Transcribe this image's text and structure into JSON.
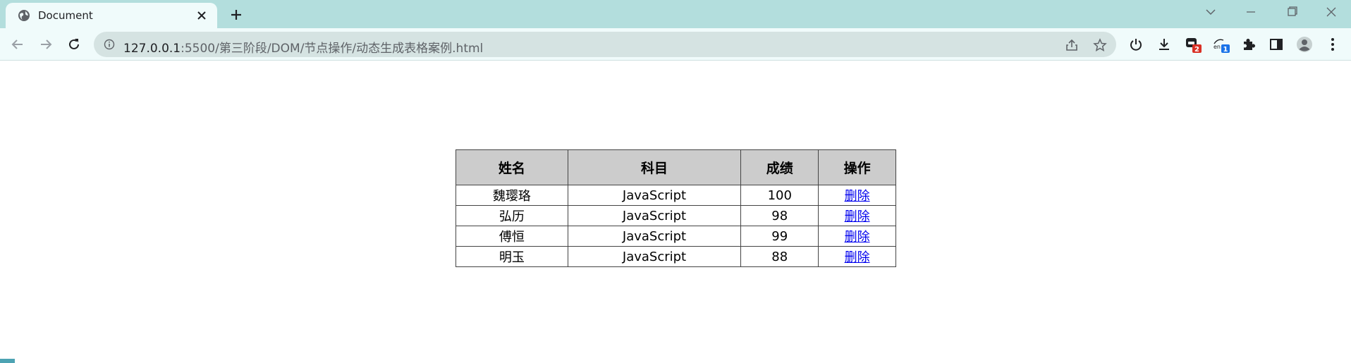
{
  "tab": {
    "title": "Document",
    "favicon": "globe-icon"
  },
  "address": {
    "host": "127.0.0.1",
    "path": ":5500/第三阶段/DOM/节点操作/动态生成表格案例.html"
  },
  "extensions": {
    "badge_one": "2",
    "badge_two": "1",
    "translate_label": "en"
  },
  "table": {
    "headers": [
      "姓名",
      "科目",
      "成绩",
      "操作"
    ],
    "rows": [
      {
        "name": "魏璎珞",
        "subject": "JavaScript",
        "score": "100",
        "action": "删除"
      },
      {
        "name": "弘历",
        "subject": "JavaScript",
        "score": "98",
        "action": "删除"
      },
      {
        "name": "傅恒",
        "subject": "JavaScript",
        "score": "99",
        "action": "删除"
      },
      {
        "name": "明玉",
        "subject": "JavaScript",
        "score": "88",
        "action": "删除"
      }
    ]
  },
  "colors": {
    "tabstrip": "#b3dedd",
    "toolbar": "#f0fbfb",
    "omnibox": "#d5e3e2",
    "header_cell": "#cccccc",
    "link": "#0000ee",
    "badge_red": "#d93025",
    "badge_blue": "#1a73e8"
  }
}
